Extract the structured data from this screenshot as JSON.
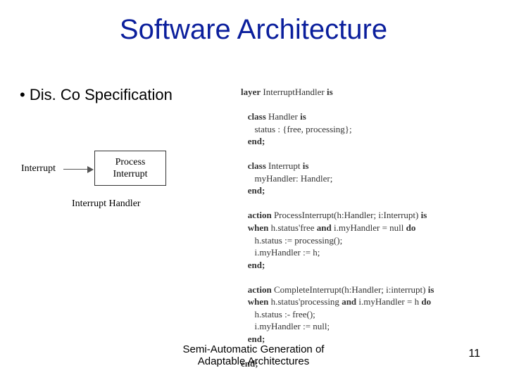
{
  "title": "Software Architecture",
  "bullet": "Dis. Co Specification",
  "diagram": {
    "input_label": "Interrupt",
    "box_line1": "Process",
    "box_line2": "Interrupt",
    "caption": "Interrupt Handler"
  },
  "code": {
    "layer_kw": "layer",
    "layer_name": " InterruptHandler ",
    "is_kw": "is",
    "class_kw": "class",
    "handler_name": " Handler ",
    "handler_body": "      status : {free, processing};",
    "end_kw": "end;",
    "interrupt_name": " Interrupt ",
    "interrupt_body": "      myHandler: Handler;",
    "action_kw": "action",
    "pi_sig": " ProcessInterrupt(h:Handler; i:Interrupt) ",
    "when_kw": "when",
    "pi_guard": " h.status'free ",
    "and_kw": "and",
    "pi_guard2": " i.myHandler = null ",
    "do_kw": "do",
    "pi_body1": "      h.status := processing();",
    "pi_body2": "      i.myHandler := h;",
    "ci_sig": " CompleteInterrupt(h:Handler; i:interrupt) ",
    "ci_guard": " h.status'processing ",
    "ci_guard2": " i.myHandler = h ",
    "ci_body1": "      h.status :- free();",
    "ci_body2": "      i.myHandler := null;"
  },
  "footer_line1": "Semi-Automatic Generation of",
  "footer_line2": "Adaptable Architectures",
  "page_number": "11"
}
